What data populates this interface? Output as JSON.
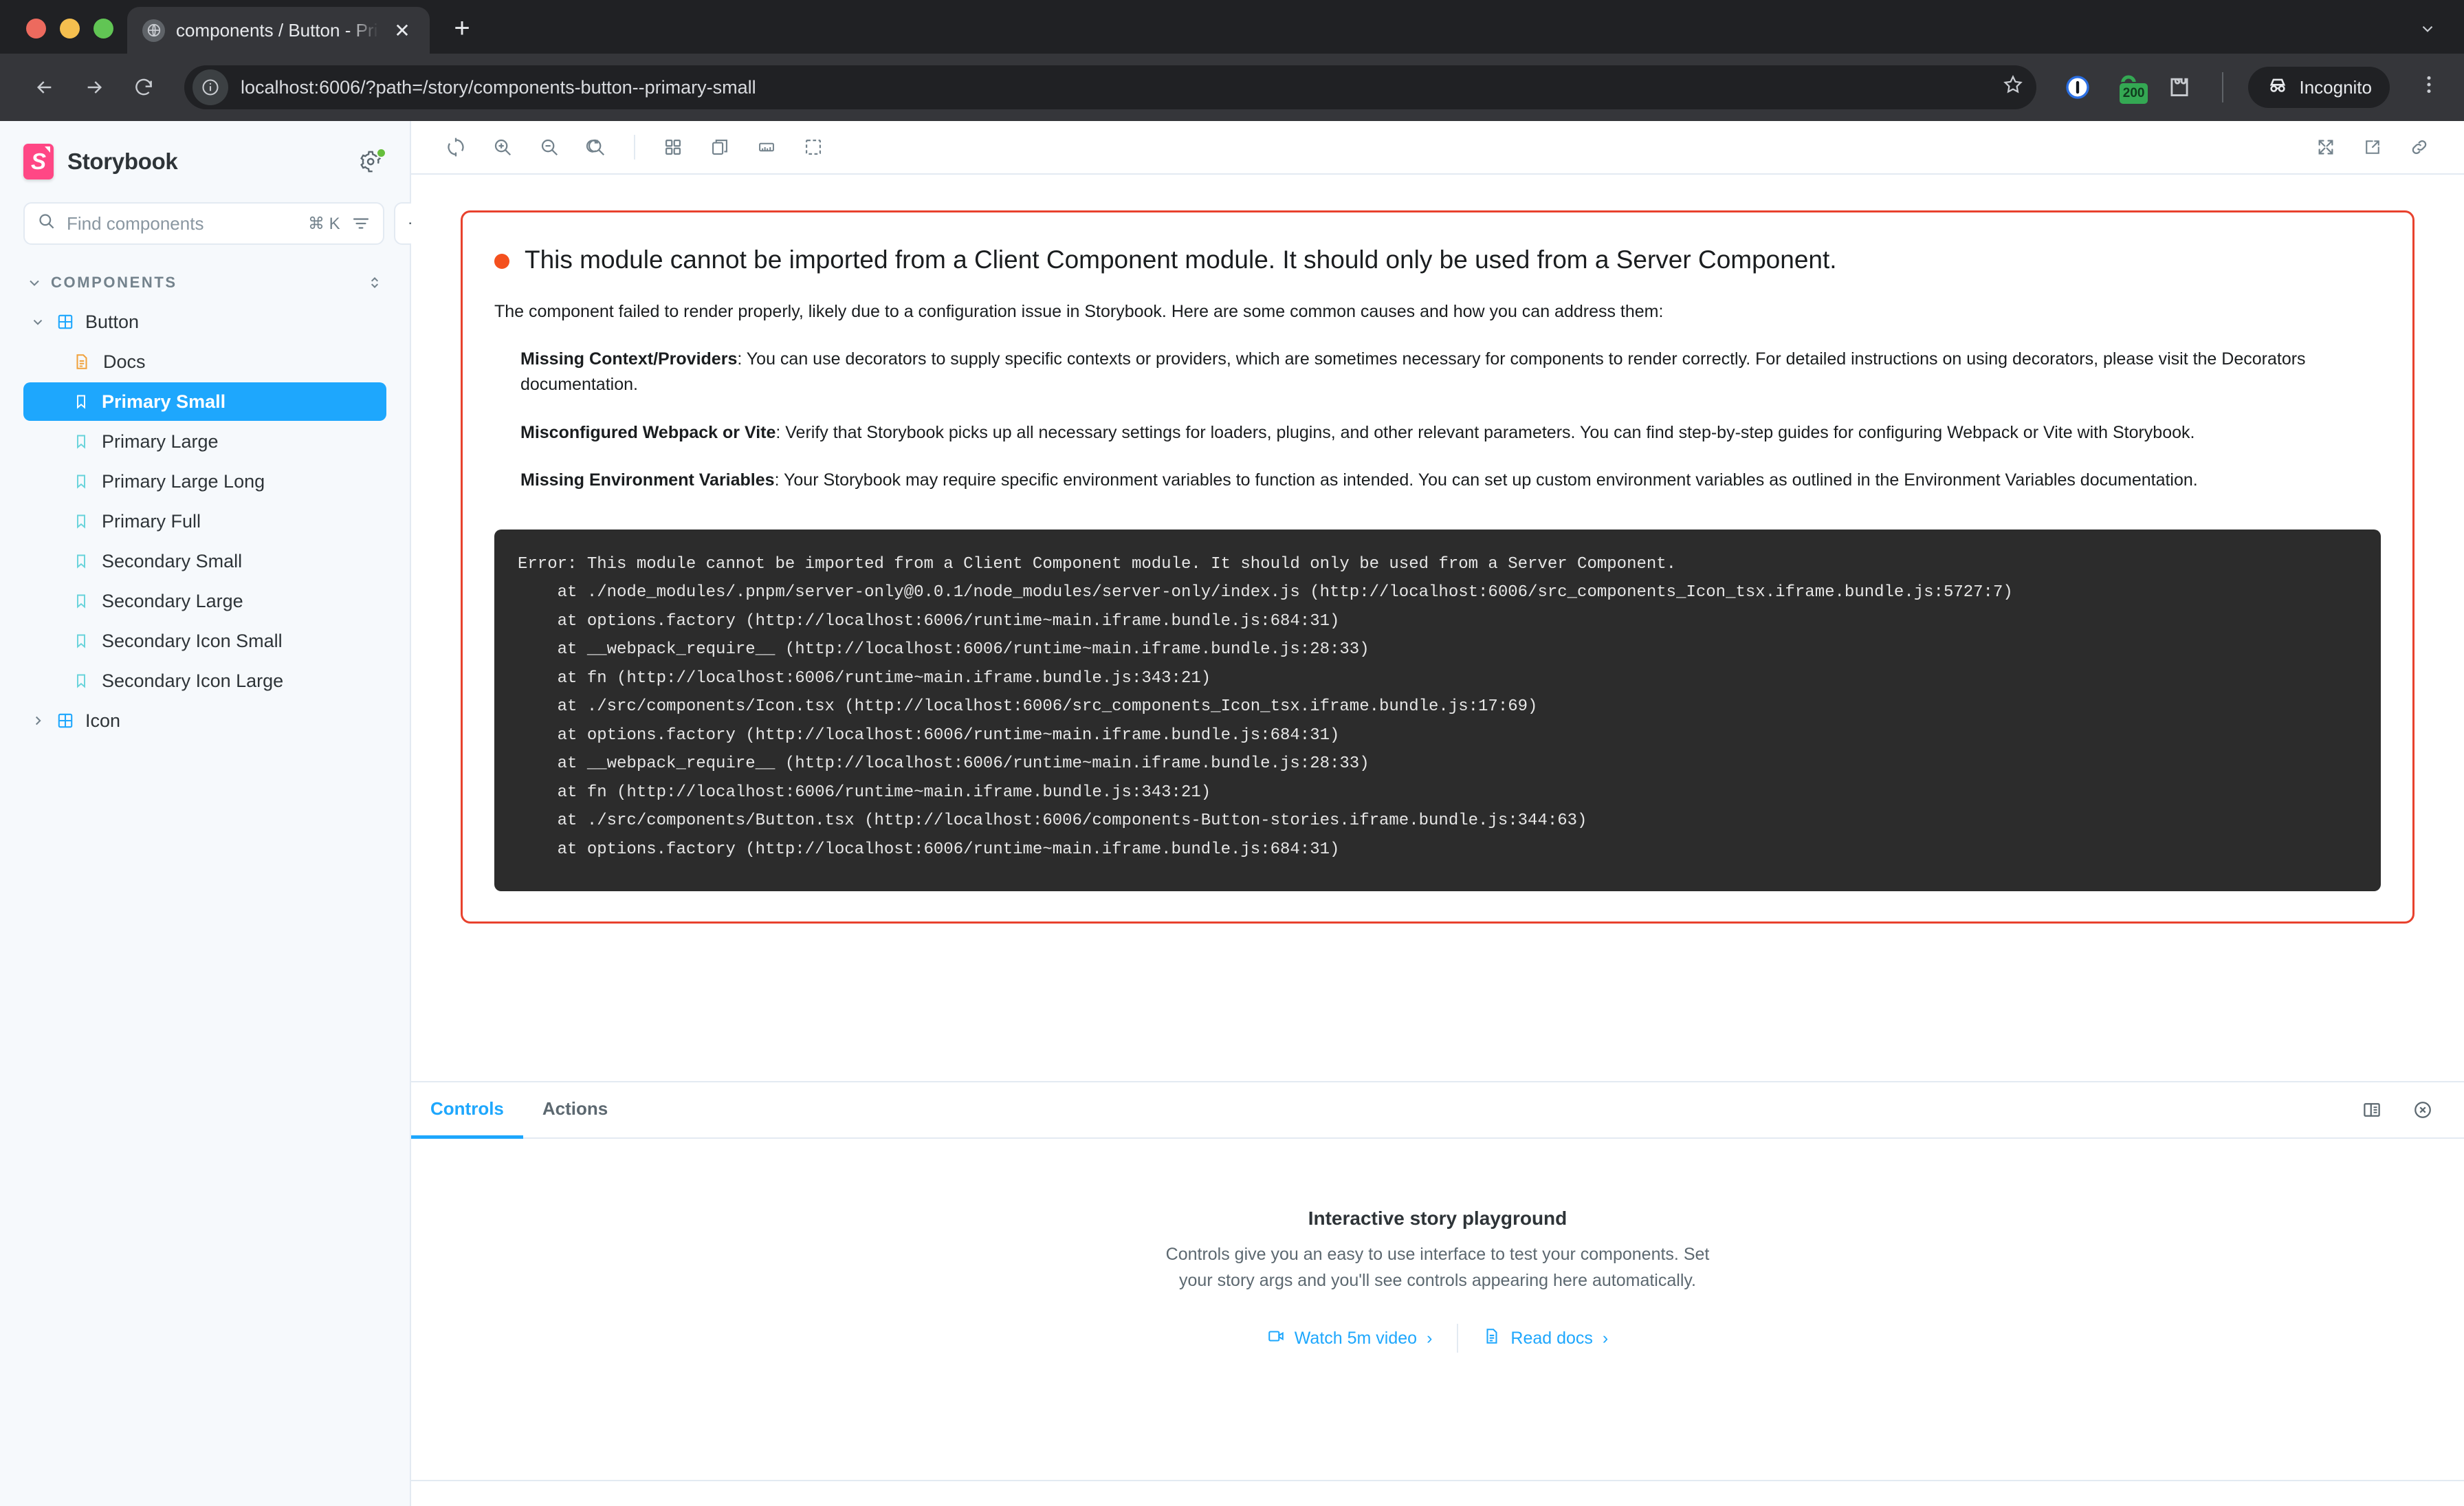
{
  "browser": {
    "tab": {
      "title": "components / Button - Primar",
      "favicon_icon": "globe-icon",
      "close_icon": "✕"
    },
    "new_tab_label": "+",
    "tabstrip_expand_icon": "⌄",
    "nav": {
      "back_icon": "←",
      "forward_icon": "→",
      "reload_icon": "⟳"
    },
    "omnibox": {
      "url": "localhost:6006/?path=/story/components-button--primary-small",
      "site_info_icon": "info-circle-icon",
      "bookmark_icon": "star-icon"
    },
    "extensions": [
      {
        "name": "password-manager-icon",
        "badge": ""
      },
      {
        "name": "status-badge-icon",
        "badge": "200"
      },
      {
        "name": "extensions-puzzle-icon",
        "badge": ""
      }
    ],
    "profile": {
      "label": "Incognito",
      "icon": "incognito-icon"
    },
    "menu_icon": "kebab-menu-icon"
  },
  "sidebar": {
    "brand": "Storybook",
    "logo_icon": "storybook-logo-icon",
    "logo_color": "#FF4785",
    "shortcuts_icon": "gear-shortcuts-icon",
    "status_dot_color": "#66BF3C",
    "search": {
      "placeholder": "Find components",
      "value": "",
      "shortcut": "⌘ K",
      "search_icon": "search-icon",
      "filter_icon": "filter-icon"
    },
    "add_button_label": "+",
    "section": {
      "label": "COMPONENTS",
      "collapse_icon": "chevron-down-icon",
      "sort_icon": "expand-collapse-icon"
    },
    "tree": [
      {
        "type": "group",
        "label": "Button",
        "expanded": true,
        "icon": "component-grid-icon",
        "selected": false
      },
      {
        "type": "docs",
        "label": "Docs",
        "icon": "docs-page-icon",
        "selected": false
      },
      {
        "type": "story",
        "label": "Primary Small",
        "icon": "story-bookmark-icon",
        "selected": true
      },
      {
        "type": "story",
        "label": "Primary Large",
        "icon": "story-bookmark-icon",
        "selected": false
      },
      {
        "type": "story",
        "label": "Primary Large Long",
        "icon": "story-bookmark-icon",
        "selected": false
      },
      {
        "type": "story",
        "label": "Primary Full",
        "icon": "story-bookmark-icon",
        "selected": false
      },
      {
        "type": "story",
        "label": "Secondary Small",
        "icon": "story-bookmark-icon",
        "selected": false
      },
      {
        "type": "story",
        "label": "Secondary Large",
        "icon": "story-bookmark-icon",
        "selected": false
      },
      {
        "type": "story",
        "label": "Secondary Icon Small",
        "icon": "story-bookmark-icon",
        "selected": false
      },
      {
        "type": "story",
        "label": "Secondary Icon Large",
        "icon": "story-bookmark-icon",
        "selected": false
      },
      {
        "type": "group",
        "label": "Icon",
        "expanded": false,
        "icon": "component-grid-icon",
        "selected": false
      }
    ]
  },
  "toolbar": {
    "left": [
      {
        "name": "remount-button",
        "icon": "remount-icon"
      },
      {
        "name": "zoom-in-button",
        "icon": "zoom-in-icon"
      },
      {
        "name": "zoom-out-button",
        "icon": "zoom-out-icon"
      },
      {
        "name": "zoom-reset-button",
        "icon": "zoom-reset-icon"
      },
      {
        "name": "backgrounds-button",
        "icon": "grid-backgrounds-icon"
      },
      {
        "name": "viewport-button",
        "icon": "viewport-copies-icon"
      },
      {
        "name": "measure-button",
        "icon": "ruler-measure-icon"
      },
      {
        "name": "outline-button",
        "icon": "outline-dashed-icon"
      }
    ],
    "right": [
      {
        "name": "fullscreen-button",
        "icon": "fullscreen-expand-icon"
      },
      {
        "name": "open-new-tab-button",
        "icon": "open-external-icon"
      },
      {
        "name": "copy-link-button",
        "icon": "link-chain-icon"
      }
    ]
  },
  "error": {
    "border_color": "#E8422E",
    "dot_color": "#F4501E",
    "title": "This module cannot be imported from a Client Component module. It should only be used from a Server Component.",
    "intro": "The component failed to render properly, likely due to a configuration issue in Storybook. Here are some common causes and how you can address them:",
    "causes": [
      {
        "term": "Missing Context/Providers",
        "text": ": You can use decorators to supply specific contexts or providers, which are sometimes necessary for components to render correctly. For detailed instructions on using decorators, please visit the Decorators documentation."
      },
      {
        "term": "Misconfigured Webpack or Vite",
        "text": ": Verify that Storybook picks up all necessary settings for loaders, plugins, and other relevant parameters. You can find step-by-step guides for configuring Webpack or Vite with Storybook."
      },
      {
        "term": "Missing Environment Variables",
        "text": ": Your Storybook may require specific environment variables to function as intended. You can set up custom environment variables as outlined in the Environment Variables documentation."
      }
    ],
    "stack": "Error: This module cannot be imported from a Client Component module. It should only be used from a Server Component.\n    at ./node_modules/.pnpm/server-only@0.0.1/node_modules/server-only/index.js (http://localhost:6006/src_components_Icon_tsx.iframe.bundle.js:5727:7)\n    at options.factory (http://localhost:6006/runtime~main.iframe.bundle.js:684:31)\n    at __webpack_require__ (http://localhost:6006/runtime~main.iframe.bundle.js:28:33)\n    at fn (http://localhost:6006/runtime~main.iframe.bundle.js:343:21)\n    at ./src/components/Icon.tsx (http://localhost:6006/src_components_Icon_tsx.iframe.bundle.js:17:69)\n    at options.factory (http://localhost:6006/runtime~main.iframe.bundle.js:684:31)\n    at __webpack_require__ (http://localhost:6006/runtime~main.iframe.bundle.js:28:33)\n    at fn (http://localhost:6006/runtime~main.iframe.bundle.js:343:21)\n    at ./src/components/Button.tsx (http://localhost:6006/components-Button-stories.iframe.bundle.js:344:63)\n    at options.factory (http://localhost:6006/runtime~main.iframe.bundle.js:684:31)"
  },
  "panel": {
    "tabs": [
      {
        "label": "Controls",
        "active": true
      },
      {
        "label": "Actions",
        "active": false
      }
    ],
    "actions": [
      {
        "name": "panel-position-button",
        "icon": "panel-layout-icon"
      },
      {
        "name": "close-panel-button",
        "icon": "close-circle-icon"
      }
    ],
    "empty": {
      "title": "Interactive story playground",
      "description": "Controls give you an easy to use interface to test your components. Set your story args and you'll see controls appearing here automatically.",
      "links": [
        {
          "label": "Watch 5m video",
          "icon": "video-icon",
          "chevron": "›"
        },
        {
          "label": "Read docs",
          "icon": "docs-icon",
          "chevron": "›"
        }
      ]
    }
  }
}
